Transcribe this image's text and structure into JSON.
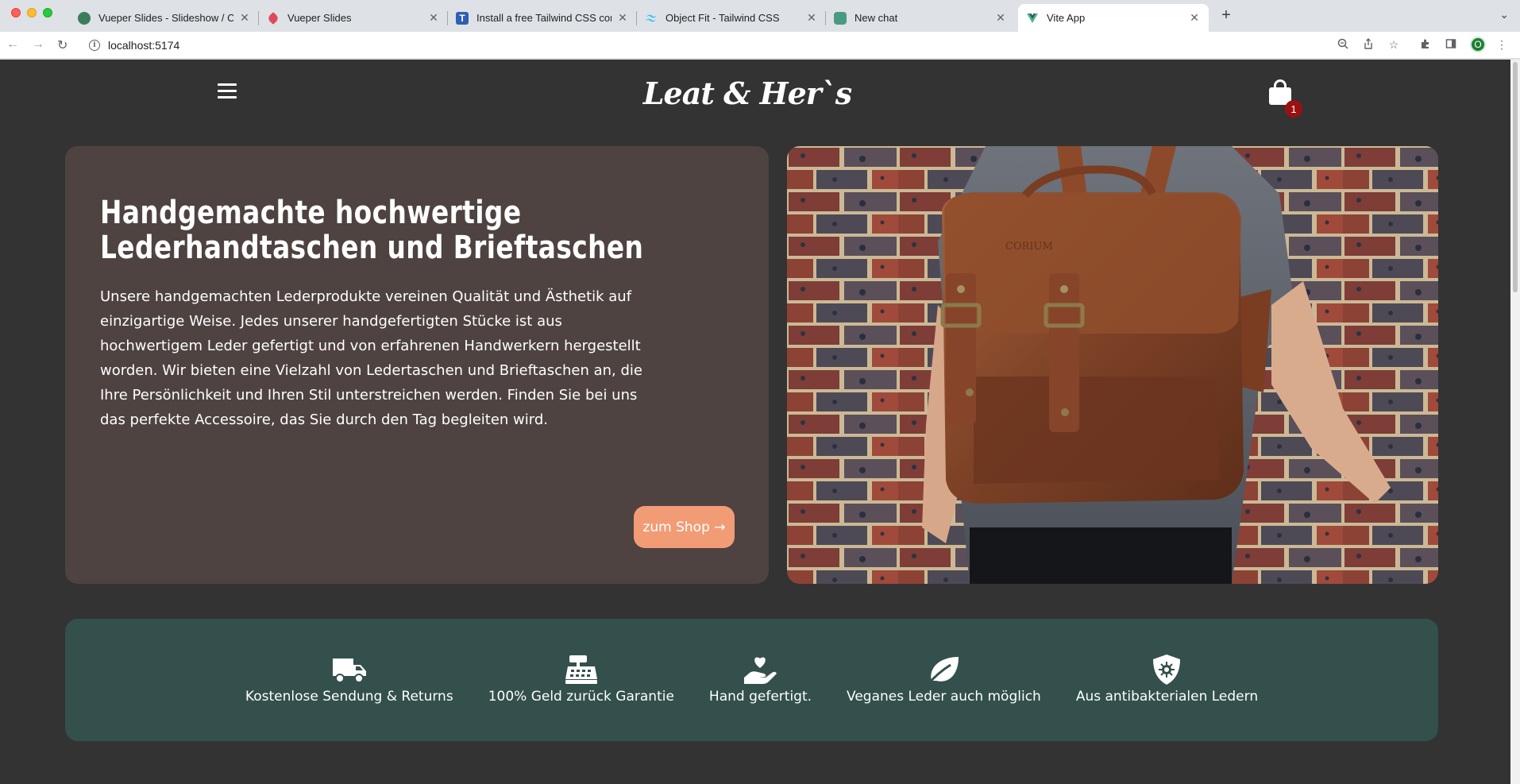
{
  "browser": {
    "tabs": [
      {
        "title": "Vueper Slides - Slideshow / Ca",
        "favicon_color": "#3a7d5a"
      },
      {
        "title": "Vueper Slides",
        "favicon_color": "#e0485b"
      },
      {
        "title": "Install a free Tailwind CSS com",
        "favicon_color": "#2d5fb3"
      },
      {
        "title": "Object Fit - Tailwind CSS",
        "favicon_color": "#38bdf8"
      },
      {
        "title": "New chat",
        "favicon_color": "#4a9a82"
      },
      {
        "title": "Vite App",
        "favicon_color": "#41b883",
        "active": true
      }
    ],
    "url": "localhost:5174",
    "profile_initial": "O"
  },
  "header": {
    "logo": "Leat & Her`s",
    "cart_count": "1"
  },
  "hero": {
    "title": "Handgemachte hochwertige Lederhandtaschen und Brieftaschen",
    "text": "Unsere handgemachten Lederprodukte vereinen Qualität und Ästhetik auf einzigartige Weise. Jedes unserer handgefertigten Stücke ist aus hochwertigem Leder gefertigt und von erfahrenen Handwerkern hergestellt worden. Wir bieten eine Vielzahl von Ledertaschen und Brieftaschen an, die Ihre Persönlichkeit und Ihren Stil unterstreichen werden. Finden Sie bei uns das perfekte Accessoire, das Sie durch den Tag begleiten wird.",
    "button_label": "zum Shop →",
    "card_color": "#4e4340",
    "button_color": "#f29c76"
  },
  "features": {
    "background": "#33504c",
    "items": [
      {
        "icon": "truck-icon",
        "label": "Kostenlose Sendung & Returns"
      },
      {
        "icon": "cash-register-icon",
        "label": "100% Geld zurück Garantie"
      },
      {
        "icon": "hand-holding-heart-icon",
        "label": "Hand gefertigt."
      },
      {
        "icon": "leaf-icon",
        "label": "Veganes Leder auch möglich"
      },
      {
        "icon": "shield-virus-icon",
        "label": "Aus antibakterialen Ledern"
      }
    ]
  }
}
